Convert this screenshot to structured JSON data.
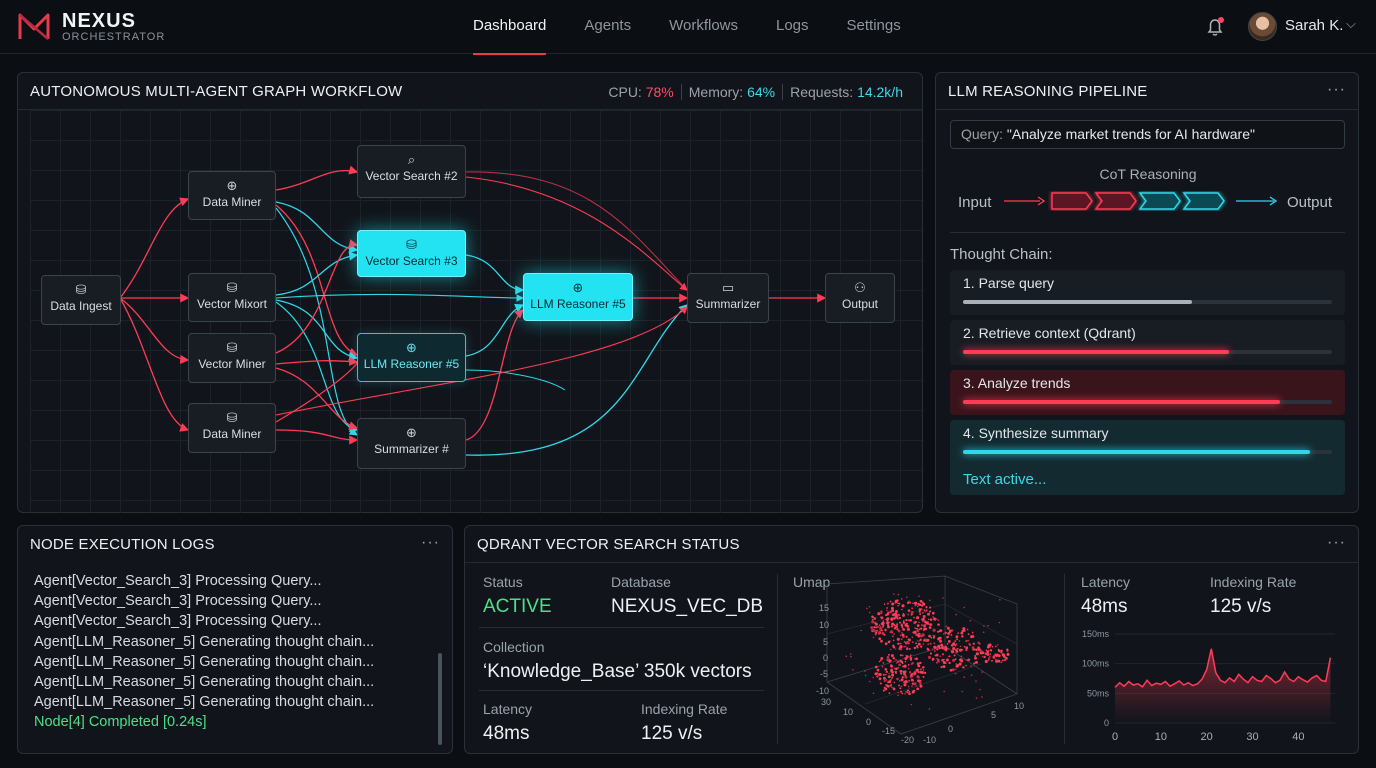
{
  "brand": {
    "title": "NEXUS",
    "subtitle": "ORCHESTRATOR"
  },
  "nav": {
    "items": [
      "Dashboard",
      "Agents",
      "Workflows",
      "Logs",
      "Settings"
    ],
    "active": "Dashboard"
  },
  "user": {
    "name": "Sarah K."
  },
  "graph_panel": {
    "title": "AUTONOMOUS MULTI-AGENT GRAPH WORKFLOW",
    "metrics": {
      "cpu_label": "CPU:",
      "cpu_value": "78%",
      "memory_label": "Memory:",
      "memory_value": "64%",
      "requests_label": "Requests:",
      "requests_value": "14.2k/h"
    },
    "nodes": {
      "data_ingest": "Data Ingest",
      "data_miner_top": "Data Miner",
      "vector_mixort": "Vector Mixort",
      "vector_miner": "Vector Miner",
      "data_miner_bottom": "Data Miner",
      "vector_search_2": "Vector Search #2",
      "vector_search_3": "Vector Search #3",
      "llm_reasoner_5a": "LLM Reasoner #5",
      "summarizer_hash": "Summarizer #",
      "llm_reasoner_5b": "LLM Reasoner #5",
      "summarizer": "Summarizer",
      "output": "Output"
    },
    "icons": {
      "data_ingest": "database-icon",
      "data_miner_top": "globe-icon",
      "vector_mixort": "database-icon",
      "vector_miner": "database-gear-icon",
      "data_miner_bottom": "database-gear-icon",
      "vector_search_2": "search-icon",
      "vector_search_3": "database-icon",
      "llm_reasoner_5a": "globe-icon",
      "summarizer_hash": "globe-icon",
      "llm_reasoner_5b": "globe-icon",
      "summarizer": "chat-icon",
      "output": "users-icon"
    },
    "colors": {
      "red": "#ff3b55",
      "cyan": "#2fd8e8"
    }
  },
  "reasoning_panel": {
    "title": "LLM REASONING PIPELINE",
    "query_label": "Query:",
    "query_value": "\"Analyze market trends for AI hardware\"",
    "cot_title": "CoT Reasoning",
    "input_label": "Input",
    "output_label": "Output",
    "thought_chain_label": "Thought Chain:",
    "steps": [
      {
        "label": "1. Parse query",
        "progress": 0.62,
        "color": "#a9b0b8"
      },
      {
        "label": "2. Retrieve context (Qdrant)",
        "progress": 0.72,
        "color": "#ff3b55"
      },
      {
        "label": "3. Analyze trends",
        "progress": 0.86,
        "color": "#ff3b55"
      },
      {
        "label": "4. Synthesize summary",
        "progress": 0.94,
        "color": "#2fd8e8"
      }
    ],
    "active_note": "Text active..."
  },
  "logs_panel": {
    "title": "NODE EXECUTION LOGS",
    "lines": [
      "Agent[Vector_Search_3] Processing Query...",
      "Agent[Vector_Search_3] Processing Query...",
      "Agent[Vector_Search_3] Processing Query...",
      "Agent[LLM_Reasoner_5] Generating thought chain...",
      "Agent[LLM_Reasoner_5] Generating thought chain...",
      "Agent[LLM_Reasoner_5] Generating thought chain...",
      "Agent[LLM_Reasoner_5] Generating thought chain...",
      "Node[4] Completed [0.24s]"
    ]
  },
  "qdrant_panel": {
    "title": "QDRANT VECTOR SEARCH STATUS",
    "status_label": "Status",
    "status_value": "ACTIVE",
    "database_label": "Database",
    "database_value": "NEXUS_VEC_DB",
    "collection_label": "Collection",
    "collection_value": "‘Knowledge_Base’ 350k vectors",
    "latency_label": "Latency",
    "latency_value": "48ms",
    "indexing_label": "Indexing Rate",
    "indexing_value": "125 v/s",
    "umap_label": "Umap",
    "umap_axis_y": [
      "15",
      "10",
      "5",
      "0",
      "-5",
      "-10"
    ],
    "umap_axis_x1": [
      "30",
      "10",
      "0",
      "-15",
      "-20"
    ],
    "umap_axis_x2": [
      "-10",
      "0",
      "5",
      "10"
    ],
    "right_latency_label": "Latency",
    "right_latency_value": "48ms",
    "right_indexing_label": "Indexing Rate",
    "right_indexing_value": "125 v/s"
  },
  "chart_data": {
    "type": "area",
    "x": [
      0,
      1,
      2,
      3,
      4,
      5,
      6,
      7,
      8,
      9,
      10,
      11,
      12,
      13,
      14,
      15,
      16,
      17,
      18,
      19,
      20,
      21,
      22,
      23,
      24,
      25,
      26,
      27,
      28,
      29,
      30,
      31,
      32,
      33,
      34,
      35,
      36,
      37,
      38,
      39,
      40,
      41,
      42,
      43,
      44,
      45,
      46,
      47
    ],
    "series": [
      {
        "values": [
          60,
          68,
          62,
          70,
          64,
          66,
          61,
          72,
          63,
          67,
          65,
          70,
          62,
          66,
          71,
          64,
          68,
          63,
          66,
          74,
          90,
          125,
          85,
          72,
          68,
          76,
          70,
          82,
          74,
          68,
          78,
          72,
          70,
          80,
          75,
          68,
          72,
          86,
          74,
          70,
          78,
          73,
          69,
          76,
          80,
          72,
          70,
          110
        ]
      }
    ],
    "xticks": [
      "0",
      "10",
      "20",
      "30",
      "40"
    ],
    "yticks": [
      "150ms",
      "100ms",
      "50ms",
      "0"
    ],
    "ylim": [
      0,
      150
    ],
    "xlim": [
      0,
      48
    ],
    "color": "#ff3b55"
  }
}
